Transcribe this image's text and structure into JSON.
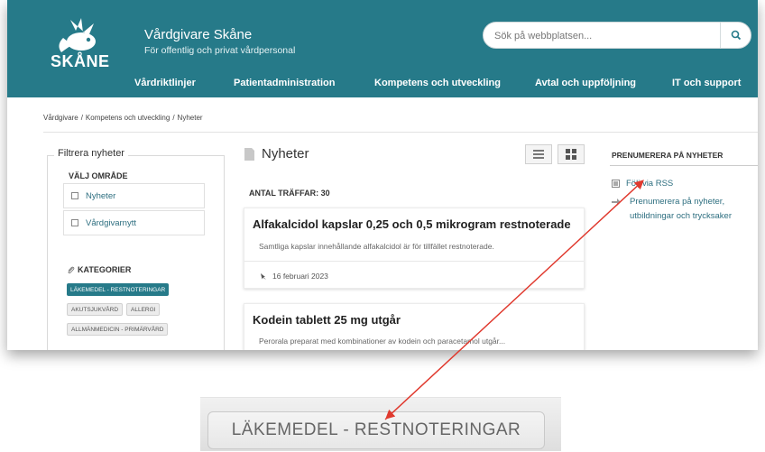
{
  "header": {
    "logo_word": "SKÅNE",
    "site_name": "Vårdgivare Skåne",
    "tagline": "För offentlig och privat vårdpersonal",
    "search_placeholder": "Sök på webbplatsen..."
  },
  "nav": [
    "Vårdriktlinjer",
    "Patientadministration",
    "Kompetens och utveckling",
    "Avtal och uppföljning",
    "IT och support"
  ],
  "breadcrumb": [
    "Vårdgivare",
    "Kompetens och utveckling",
    "Nyheter"
  ],
  "filter": {
    "legend": "Filtrera nyheter",
    "area_title": "VÄLJ OMRÅDE",
    "areas": [
      "Nyheter",
      "Vårdgivarnytt"
    ],
    "categories_title": "KATEGORIER",
    "tags": [
      "LÄKEMEDEL - RESTNOTERINGAR",
      "AKUTSJUKVÅRD",
      "ALLERGI",
      "ALLMÄNMEDICIN - PRIMÄRVÅRD"
    ]
  },
  "news": {
    "title": "Nyheter",
    "hits": "ANTAL TRÄFFAR: 30",
    "articles": [
      {
        "title": "Alfakalcidol kapslar 0,25 och 0,5 mikrogram restnoterade",
        "summary": "Samtliga kapslar innehållande alfakalcidol är för tillfället restnoterade.",
        "date": "16 februari 2023"
      },
      {
        "title": "Kodein tablett 25 mg utgår",
        "summary": "Perorala preparat med kombinationer av kodein och paracetamol utgår..."
      }
    ]
  },
  "subscribe": {
    "title": "PRENUMERERA PÅ NYHETER",
    "rss": "Följ via RSS",
    "newsletter_line1": "Prenumerera på nyheter,",
    "newsletter_line2": "utbildningar och trycksaker"
  },
  "zoom": {
    "tag_label": "LÄKEMEDEL - RESTNOTERINGAR"
  },
  "colors": {
    "brand": "#267a89",
    "annotation_arrow": "#e03a2f"
  }
}
